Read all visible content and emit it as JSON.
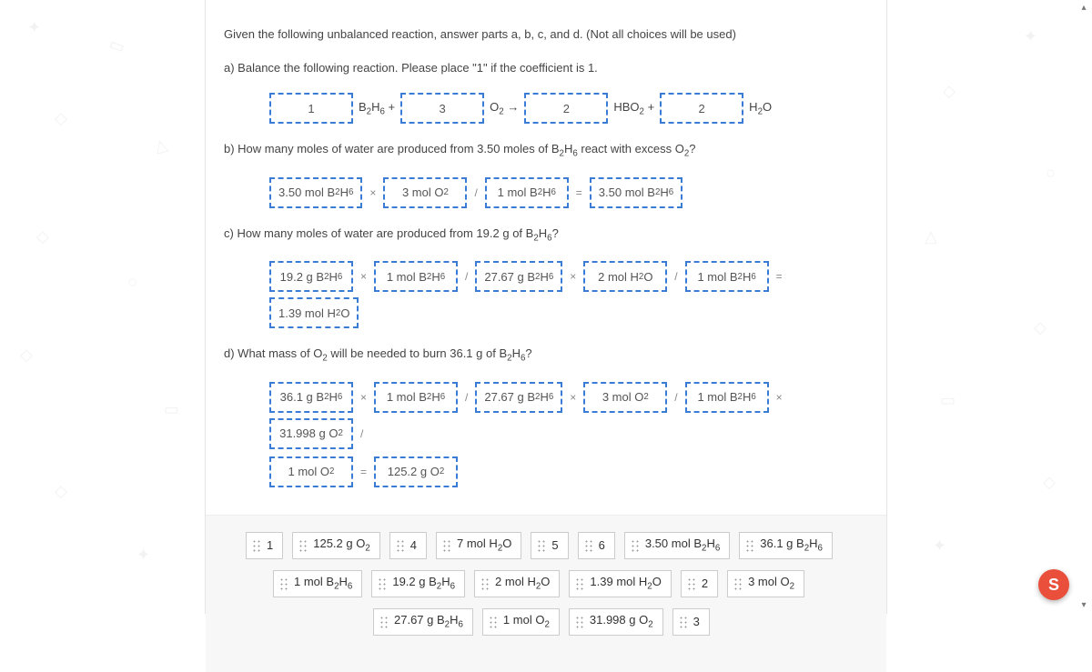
{
  "intro": "Given the following unbalanced reaction, answer parts a, b, c, and d. (Not all choices will be used)",
  "a": {
    "prompt": "a) Balance the following reaction. Please place \"1\" if the coefficient is 1.",
    "b1": "1",
    "t1": "B₂H₆ +",
    "b2": "3",
    "t2": "O₂ →",
    "b3": "2",
    "t3": "HBO₂ +",
    "b4": "2",
    "t4": "H₂O"
  },
  "b": {
    "prompt": "b) How many moles of water are produced from 3.50 moles of B₂H₆ react with excess O₂?",
    "v1": "3.50 mol B₂H₆",
    "v2": "3 mol O₂",
    "v3": "1 mol B₂H₆",
    "v4": "3.50 mol B₂H₆"
  },
  "c": {
    "prompt": "c) How many  moles of water are produced from 19.2 g of B₂H₆?",
    "v1": "19.2 g B₂H₆",
    "v2": "1 mol B₂H₆",
    "v3": "27.67 g B₂H₆",
    "v4": "2 mol H₂O",
    "v5": "1 mol B₂H₆",
    "v6": "1.39 mol H₂O"
  },
  "d": {
    "prompt": "d) What mass of O₂ will be needed to burn 36.1 g of B₂H₆?",
    "v1": "36.1 g B₂H₆",
    "v2": "1 mol B₂H₆",
    "v3": "27.67 g B₂H₆",
    "v4": "3 mol O₂",
    "v5": "1 mol B₂H₆",
    "v6": "31.998 g O₂",
    "v7": "1 mol O₂",
    "v8": "125.2 g O₂"
  },
  "bank": {
    "r1": [
      "1",
      "125.2 g O₂",
      "4",
      "7 mol H₂O",
      "5",
      "6",
      "3.50 mol B₂H₆",
      "36.1 g B₂H₆"
    ],
    "r2": [
      "1 mol B₂H₆",
      "19.2 g B₂H₆",
      "2 mol H₂O",
      "1.39 mol H₂O",
      "2",
      "3 mol O₂"
    ],
    "r3": [
      "27.67 g B₂H₆",
      "1 mol O₂",
      "31.998 g O₂",
      "3"
    ]
  },
  "ops": {
    "times": "×",
    "div": "/",
    "eq": "="
  },
  "badge": "S"
}
